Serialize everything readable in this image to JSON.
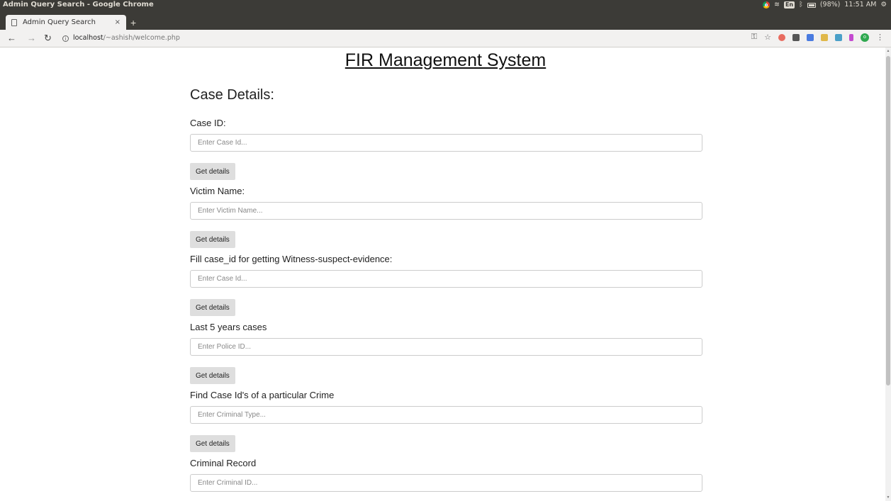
{
  "os": {
    "window_title": "Admin Query Search - Google Chrome",
    "lang": "En",
    "battery": "(98%)",
    "time": "11:51 AM"
  },
  "browser": {
    "tab_title": "Admin Query Search",
    "tab_close": "×",
    "new_tab": "+",
    "url_host": "localhost",
    "url_path": "/~ashish/welcome.php"
  },
  "page": {
    "title": "FIR Management System",
    "section_title": "Case Details:",
    "fields": [
      {
        "label": "Case ID:",
        "placeholder": "Enter Case Id...",
        "button": "Get details"
      },
      {
        "label": "Victim Name:",
        "placeholder": "Enter Victim Name...",
        "button": "Get details"
      },
      {
        "label": "Fill case_id for getting Witness-suspect-evidence:",
        "placeholder": "Enter Case Id...",
        "button": "Get details"
      },
      {
        "label": "Last 5 years cases",
        "placeholder": "Enter Police ID...",
        "button": "Get details"
      },
      {
        "label": "Find Case Id's of a particular Crime",
        "placeholder": "Enter Criminal Type...",
        "button": "Get details"
      },
      {
        "label": "Criminal Record",
        "placeholder": "Enter Criminal ID..."
      }
    ]
  }
}
